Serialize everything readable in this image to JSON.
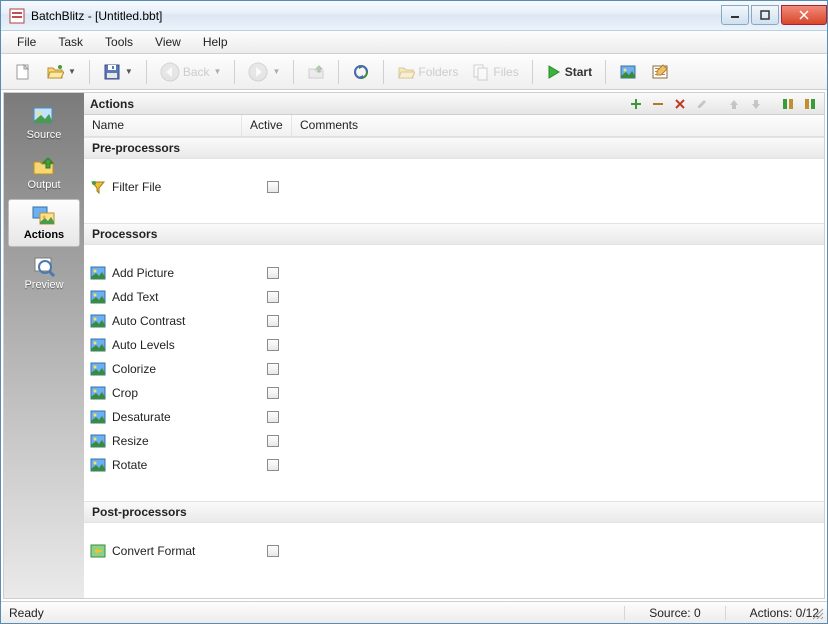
{
  "window": {
    "title": "BatchBlitz - [Untitled.bbt]"
  },
  "menu": {
    "items": [
      "File",
      "Task",
      "Tools",
      "View",
      "Help"
    ]
  },
  "toolbar": {
    "back_label": "Back",
    "folders_label": "Folders",
    "files_label": "Files",
    "start_label": "Start"
  },
  "sidebar": {
    "items": [
      {
        "label": "Source"
      },
      {
        "label": "Output"
      },
      {
        "label": "Actions"
      },
      {
        "label": "Preview"
      }
    ],
    "selected_index": 2
  },
  "panel": {
    "title": "Actions",
    "columns": {
      "name": "Name",
      "active": "Active",
      "comments": "Comments"
    },
    "groups": [
      {
        "label": "Pre-processors",
        "rows": [
          {
            "name": "Filter File",
            "active": false,
            "icon": "filter-icon"
          }
        ]
      },
      {
        "label": "Processors",
        "rows": [
          {
            "name": "Add Picture",
            "active": false,
            "icon": "picture-icon"
          },
          {
            "name": "Add Text",
            "active": false,
            "icon": "picture-icon"
          },
          {
            "name": "Auto Contrast",
            "active": false,
            "icon": "picture-icon"
          },
          {
            "name": "Auto Levels",
            "active": false,
            "icon": "picture-icon"
          },
          {
            "name": "Colorize",
            "active": false,
            "icon": "picture-icon"
          },
          {
            "name": "Crop",
            "active": false,
            "icon": "picture-icon"
          },
          {
            "name": "Desaturate",
            "active": false,
            "icon": "picture-icon"
          },
          {
            "name": "Resize",
            "active": false,
            "icon": "picture-icon"
          },
          {
            "name": "Rotate",
            "active": false,
            "icon": "picture-icon"
          }
        ]
      },
      {
        "label": "Post-processors",
        "rows": [
          {
            "name": "Convert Format",
            "active": false,
            "icon": "convert-icon"
          }
        ]
      }
    ]
  },
  "status": {
    "left": "Ready",
    "source": "Source: 0",
    "actions": "Actions: 0/12"
  }
}
